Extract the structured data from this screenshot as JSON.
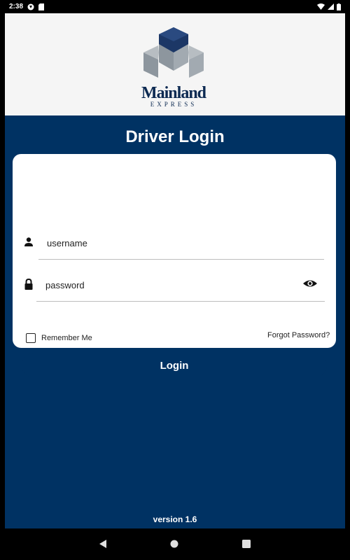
{
  "status_bar": {
    "time": "2:38",
    "icons": [
      "notification-icon",
      "sd-card-icon",
      "wifi-icon",
      "cellular-icon",
      "battery-icon"
    ]
  },
  "header": {
    "logo_word": "Mainland",
    "logo_sub": "EXPRESS"
  },
  "login": {
    "title": "Driver Login",
    "username_placeholder": "username",
    "password_placeholder": "password",
    "remember_label": "Remember Me",
    "remember_checked": false,
    "forgot_label": "Forgot Password?",
    "login_label": "Login"
  },
  "footer": {
    "version": "version 1.6"
  },
  "colors": {
    "primary": "#003263",
    "header_bg": "#f5f5f5",
    "logo_dark": "#1c3766",
    "logo_gray": "#8d969e"
  },
  "nav_bar": {
    "icons": [
      "back-icon",
      "home-icon",
      "recents-icon"
    ]
  }
}
